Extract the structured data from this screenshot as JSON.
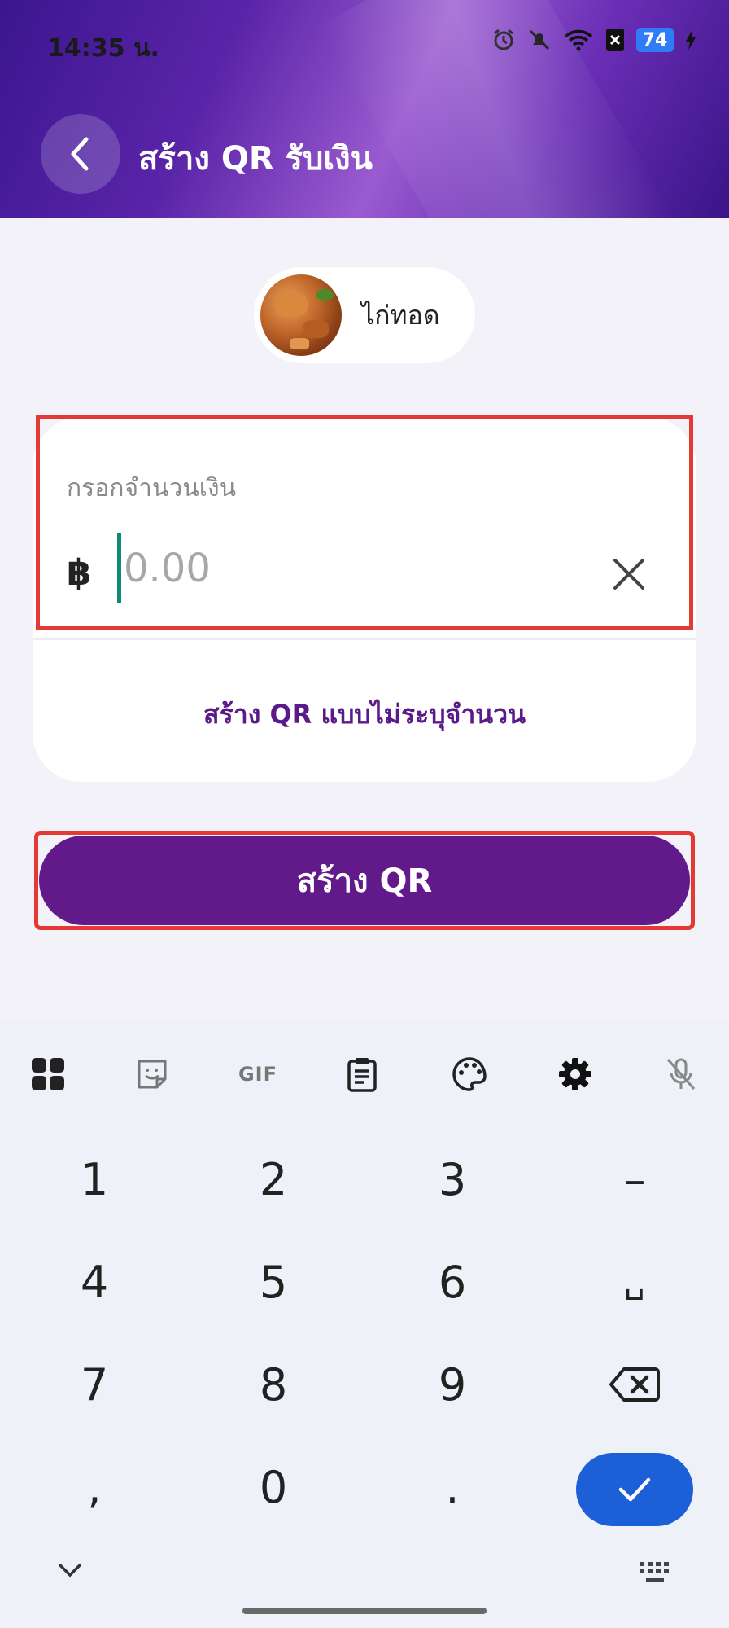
{
  "status_bar": {
    "time": "14:35 น.",
    "battery": "74"
  },
  "header": {
    "title": "สร้าง QR รับเงิน"
  },
  "merchant": {
    "name": "ไก่ทอด"
  },
  "amount": {
    "label": "กรอกจำนวนเงิน",
    "currency_symbol": "฿",
    "value": "",
    "placeholder": "0.00"
  },
  "links": {
    "no_amount": "สร้าง QR แบบไม่ระบุจำนวน"
  },
  "buttons": {
    "create_qr": "สร้าง QR"
  },
  "keyboard": {
    "toolbar": {
      "gif_label": "GIF",
      "icons": [
        "apps-grid-icon",
        "sticker-icon",
        "gif-icon",
        "clipboard-icon",
        "palette-icon",
        "settings-gear-icon",
        "mic-off-icon"
      ]
    },
    "keys": [
      "1",
      "2",
      "3",
      "–",
      "4",
      "5",
      "6",
      "␣",
      "7",
      "8",
      "9",
      ",",
      "0",
      "."
    ],
    "action_icons": [
      "backspace-icon",
      "confirm-check-icon",
      "hide-keyboard-chevron-icon",
      "keyboard-icon"
    ]
  },
  "colors": {
    "accent": "#62198a",
    "link": "#5b1a8a",
    "highlight_outline": "#e53935",
    "keyboard_confirm": "#1c5fd6"
  }
}
